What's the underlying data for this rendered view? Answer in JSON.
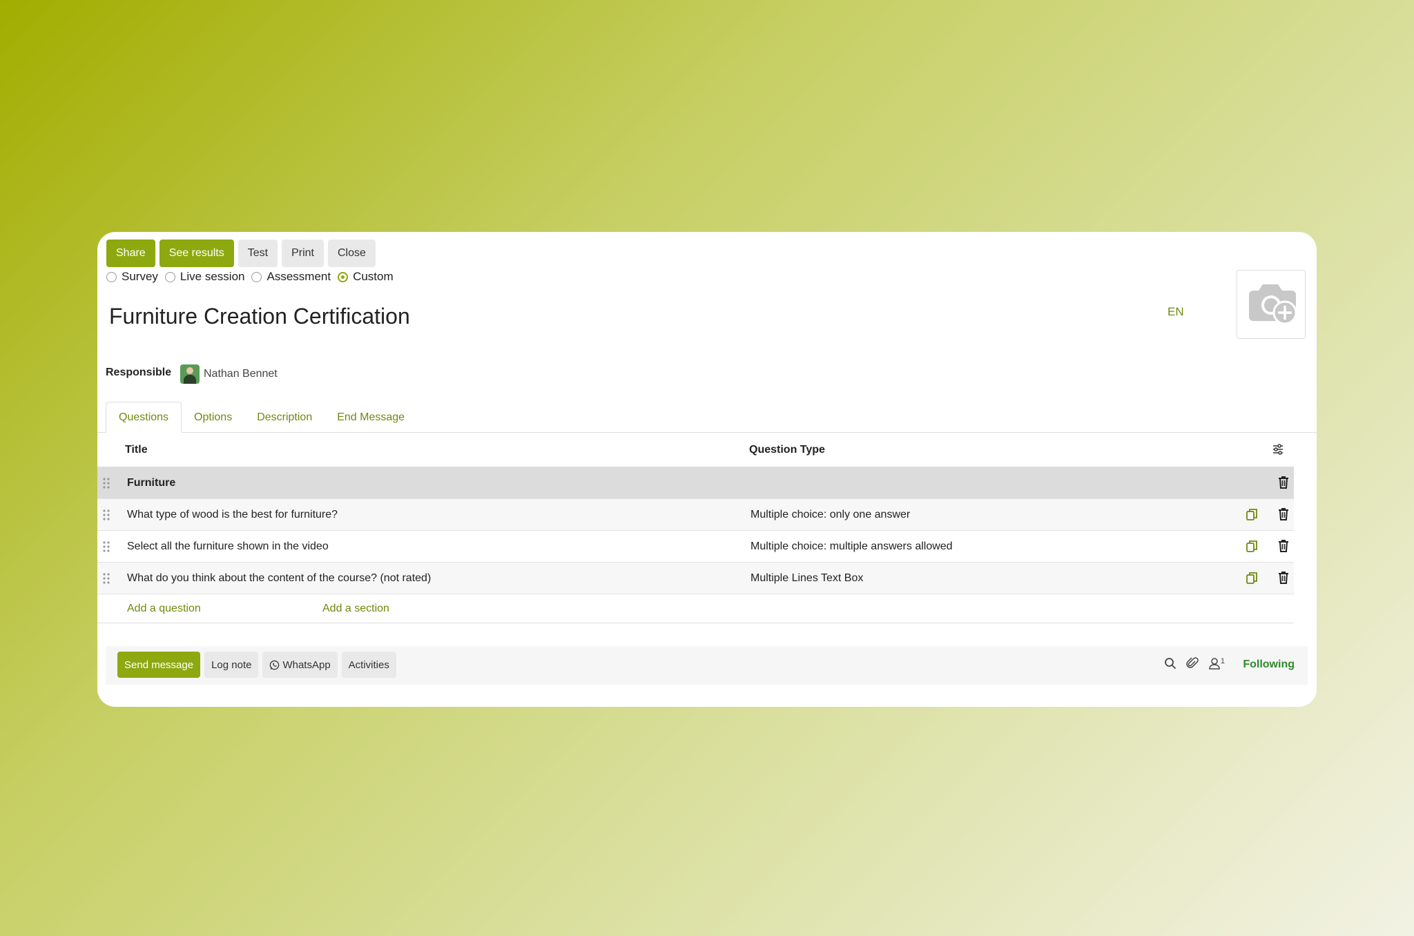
{
  "toolbar": {
    "share": "Share",
    "see_results": "See results",
    "test": "Test",
    "print": "Print",
    "close": "Close"
  },
  "survey_type": {
    "options": [
      "Survey",
      "Live session",
      "Assessment",
      "Custom"
    ],
    "selected": "Custom"
  },
  "record": {
    "title": "Furniture Creation Certification",
    "language": "EN",
    "responsible_label": "Responsible",
    "responsible_name": "Nathan Bennet"
  },
  "tabs": [
    "Questions",
    "Options",
    "Description",
    "End Message"
  ],
  "active_tab": "Questions",
  "table": {
    "headers": {
      "title": "Title",
      "type": "Question Type"
    },
    "section": "Furniture",
    "rows": [
      {
        "title": "What type of wood is the best for furniture?",
        "type": "Multiple choice: only one answer"
      },
      {
        "title": "Select all the furniture shown in the video",
        "type": "Multiple choice: multiple answers allowed"
      },
      {
        "title": "What do you think about the content of the course? (not rated)",
        "type": "Multiple Lines Text Box"
      }
    ],
    "add_question": "Add a question",
    "add_section": "Add a section"
  },
  "chatter": {
    "send_message": "Send message",
    "log_note": "Log note",
    "whatsapp": "WhatsApp",
    "activities": "Activities",
    "followers_count": "1",
    "following": "Following"
  },
  "colors": {
    "accent": "#8ea80f",
    "link": "#6f8a0c",
    "following": "#2e8a2a"
  },
  "icons": [
    "camera-plus-icon",
    "drag-handle-icon",
    "copy-icon",
    "trash-icon",
    "settings-sliders-icon",
    "whatsapp-icon",
    "search-icon",
    "paperclip-icon",
    "user-icon"
  ]
}
